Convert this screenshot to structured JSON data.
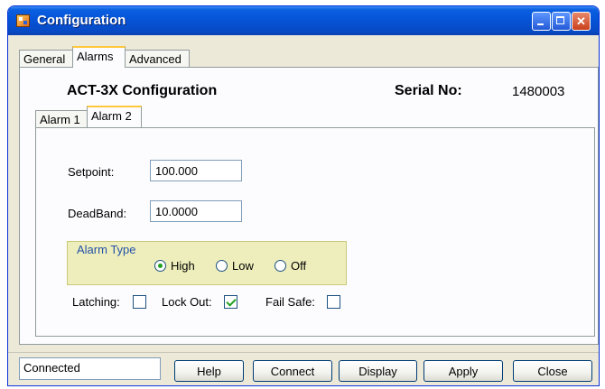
{
  "window": {
    "title": "Configuration",
    "icons": {
      "app": "app-icon",
      "minimize": "minimize-icon",
      "maximize": "maximize-icon",
      "close": "close-x-icon"
    }
  },
  "main_tabs": [
    {
      "label": "General",
      "active": false
    },
    {
      "label": "Alarms",
      "active": true
    },
    {
      "label": "Advanced",
      "active": false
    }
  ],
  "header": {
    "title": "ACT-3X Configuration",
    "serial_label": "Serial No:",
    "serial_value": "1480003"
  },
  "sub_tabs": [
    {
      "label": "Alarm 1",
      "active": false
    },
    {
      "label": "Alarm 2",
      "active": true
    }
  ],
  "fields": {
    "setpoint": {
      "label": "Setpoint:",
      "value": "100.000"
    },
    "deadband": {
      "label": "DeadBand:",
      "value": "10.0000"
    }
  },
  "alarm_type": {
    "label": "Alarm Type",
    "options": [
      {
        "label": "High",
        "selected": true
      },
      {
        "label": "Low",
        "selected": false
      },
      {
        "label": "Off",
        "selected": false
      }
    ]
  },
  "options": {
    "latching": {
      "label": "Latching:",
      "checked": false
    },
    "lockout": {
      "label": "Lock Out:",
      "checked": true
    },
    "failsafe": {
      "label": "Fail Safe:",
      "checked": false
    }
  },
  "status": "Connected",
  "buttons": {
    "help": "Help",
    "connect": "Connect",
    "display": "Display",
    "apply": "Apply",
    "close": "Close"
  },
  "colors": {
    "titlebar": "#0553d6",
    "tab_highlight": "#ffc83c",
    "group_background": "#eeeebc",
    "check_mark": "#21a121",
    "window_face": "#ece9d8"
  }
}
